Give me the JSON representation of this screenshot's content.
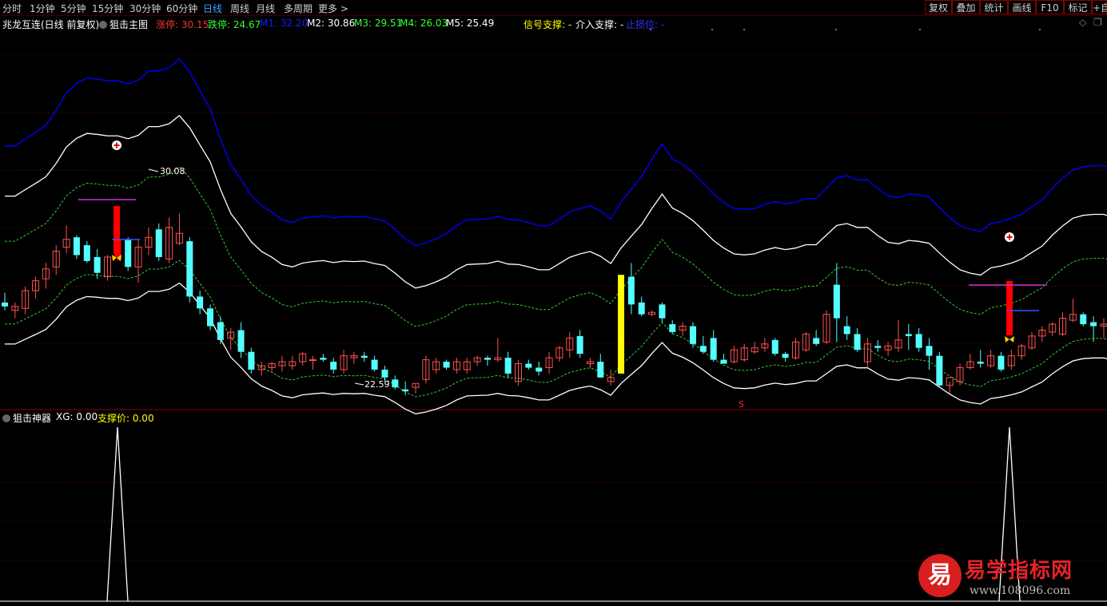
{
  "toolbar": {
    "periods": [
      "分时",
      "1分钟",
      "5分钟",
      "15分钟",
      "30分钟",
      "60分钟",
      "日线",
      "周线",
      "月线",
      "多周期",
      "更多 >"
    ],
    "active_period": "日线",
    "right_buttons": [
      "复权",
      "叠加",
      "统计",
      "画线",
      "F10",
      "标记",
      "+自"
    ]
  },
  "main_panel": {
    "stock_title": "兆龙互连(日线 前复权)",
    "formula_name": "狙击主图",
    "zt_label": "涨停: 30.15",
    "dt_label": "跌停: 24.67",
    "m1_label": "M1: 32.20",
    "m2_label": "M2: 30.86",
    "m3_label": "M3: 29.51",
    "m4_label": "M4: 26.03",
    "m5_label": "M5: 25.49",
    "signal_label": "信号支撑: -",
    "entry_label": "介入支撑: -",
    "stop_label": "止损位: -",
    "high_marker": "30.08",
    "low_marker": "22.59",
    "s_marker": "S",
    "colors": {
      "up": "#ff5050",
      "down": "#54ffff",
      "ma_blue": "#0000ee",
      "ma_white": "#ffffff",
      "ma_green": "#33cc33",
      "grid": "#5a0000",
      "highlight_yellow": "#ffff00",
      "highlight_red": "#ff0000"
    }
  },
  "sub_panel": {
    "name": "狙击神器",
    "xg_label": "XG: 0.00",
    "support_label": "支撑价: 0.00"
  },
  "watermark": {
    "mark": "易",
    "title": "易学指标网",
    "url": "www.108096.com"
  },
  "chart_data": {
    "type": "candlestick",
    "price_range": [
      20.5,
      39.5
    ],
    "ohlc": [
      [
        25.6,
        26.1,
        25.2,
        25.4
      ],
      [
        25.2,
        25.6,
        24.8,
        25.4
      ],
      [
        25.3,
        26.4,
        25.0,
        26.2
      ],
      [
        26.2,
        26.9,
        25.8,
        26.7
      ],
      [
        26.8,
        27.6,
        26.3,
        27.3
      ],
      [
        27.4,
        28.5,
        27.0,
        28.2
      ],
      [
        28.4,
        29.5,
        28.1,
        28.8
      ],
      [
        28.9,
        29.0,
        27.8,
        28.0
      ],
      [
        28.5,
        28.7,
        27.6,
        27.7
      ],
      [
        27.9,
        28.3,
        26.8,
        27.1
      ],
      [
        26.9,
        28.0,
        26.7,
        27.9
      ],
      [
        27.9,
        28.9,
        27.7,
        28.8
      ],
      [
        28.8,
        28.9,
        27.2,
        27.4
      ],
      [
        27.4,
        28.8,
        26.6,
        28.4
      ],
      [
        28.4,
        29.4,
        28.0,
        28.9
      ],
      [
        29.3,
        29.6,
        27.7,
        27.9
      ],
      [
        27.8,
        29.9,
        27.6,
        29.4
      ],
      [
        28.6,
        30.1,
        28.5,
        29.1
      ],
      [
        28.7,
        28.9,
        25.6,
        25.9
      ],
      [
        25.9,
        26.2,
        25.0,
        25.3
      ],
      [
        25.3,
        25.5,
        24.2,
        24.4
      ],
      [
        24.6,
        24.9,
        23.5,
        23.7
      ],
      [
        23.8,
        24.3,
        23.2,
        24.1
      ],
      [
        24.2,
        24.6,
        22.8,
        23.1
      ],
      [
        23.1,
        23.3,
        22.0,
        22.2
      ],
      [
        22.2,
        22.6,
        21.9,
        22.4
      ],
      [
        22.3,
        22.6,
        22.1,
        22.5
      ],
      [
        22.4,
        22.9,
        22.1,
        22.6
      ],
      [
        22.4,
        22.9,
        22.2,
        22.6
      ],
      [
        22.6,
        23.1,
        22.4,
        23.0
      ],
      [
        22.7,
        22.9,
        22.2,
        22.7
      ],
      [
        22.8,
        23.0,
        22.6,
        22.7
      ],
      [
        22.6,
        22.8,
        22.0,
        22.2
      ],
      [
        22.2,
        23.2,
        22.0,
        22.9
      ],
      [
        22.8,
        23.1,
        22.5,
        22.9
      ],
      [
        22.9,
        23.1,
        22.6,
        22.8
      ],
      [
        22.7,
        22.9,
        22.1,
        22.2
      ],
      [
        22.2,
        22.4,
        21.6,
        21.8
      ],
      [
        21.7,
        21.9,
        21.2,
        21.3
      ],
      [
        21.2,
        21.6,
        20.9,
        21.1
      ],
      [
        21.3,
        21.5,
        21.0,
        21.5
      ],
      [
        21.7,
        22.9,
        21.5,
        22.7
      ],
      [
        22.2,
        22.8,
        22.0,
        22.6
      ],
      [
        22.6,
        22.7,
        22.2,
        22.3
      ],
      [
        22.2,
        22.8,
        22.0,
        22.6
      ],
      [
        22.2,
        22.8,
        22.0,
        22.6
      ],
      [
        22.6,
        22.9,
        22.4,
        22.8
      ],
      [
        22.8,
        22.9,
        22.4,
        22.7
      ],
      [
        22.7,
        23.8,
        22.6,
        22.8
      ],
      [
        22.8,
        23.1,
        21.8,
        22.0
      ],
      [
        21.6,
        22.7,
        21.4,
        22.5
      ],
      [
        22.5,
        22.7,
        22.2,
        22.3
      ],
      [
        22.3,
        22.6,
        21.9,
        22.1
      ],
      [
        22.3,
        23.1,
        22.0,
        22.8
      ],
      [
        22.8,
        23.4,
        22.6,
        23.3
      ],
      [
        23.2,
        24.1,
        22.8,
        23.8
      ],
      [
        23.9,
        24.2,
        22.8,
        23.0
      ],
      [
        22.5,
        22.8,
        22.3,
        22.6
      ],
      [
        22.6,
        23.0,
        22.0,
        21.8
      ],
      [
        21.6,
        22.2,
        21.4,
        21.8
      ],
      [
        22.0,
        27.0,
        22.0,
        27.0
      ],
      [
        26.9,
        27.6,
        25.0,
        25.5
      ],
      [
        25.6,
        25.9,
        24.9,
        25.0
      ],
      [
        25.0,
        25.2,
        24.9,
        25.1
      ],
      [
        25.5,
        25.6,
        24.6,
        24.8
      ],
      [
        24.5,
        24.7,
        24.0,
        24.1
      ],
      [
        24.2,
        24.6,
        23.9,
        24.4
      ],
      [
        24.4,
        24.6,
        23.3,
        23.5
      ],
      [
        23.4,
        23.9,
        23.0,
        23.1
      ],
      [
        23.8,
        24.2,
        22.6,
        22.7
      ],
      [
        22.7,
        23.0,
        22.5,
        22.5
      ],
      [
        22.6,
        23.4,
        22.5,
        23.2
      ],
      [
        22.7,
        23.5,
        22.6,
        23.3
      ],
      [
        23.1,
        23.6,
        23.0,
        23.3
      ],
      [
        23.3,
        23.8,
        23.1,
        23.5
      ],
      [
        23.7,
        23.8,
        22.9,
        23.0
      ],
      [
        23.0,
        23.1,
        22.6,
        22.8
      ],
      [
        22.8,
        23.8,
        22.7,
        23.6
      ],
      [
        23.2,
        24.1,
        23.1,
        24.0
      ],
      [
        23.8,
        24.2,
        23.4,
        23.5
      ],
      [
        23.6,
        25.2,
        23.5,
        25.0
      ],
      [
        26.5,
        27.6,
        23.6,
        24.8
      ],
      [
        24.4,
        24.9,
        23.7,
        24.0
      ],
      [
        24.0,
        24.3,
        23.1,
        23.2
      ],
      [
        22.6,
        23.8,
        22.3,
        23.5
      ],
      [
        23.4,
        23.7,
        23.1,
        23.3
      ],
      [
        23.2,
        23.6,
        22.9,
        23.4
      ],
      [
        23.3,
        24.7,
        23.1,
        23.7
      ],
      [
        24.0,
        24.5,
        23.2,
        23.9
      ],
      [
        24.0,
        24.3,
        23.1,
        23.3
      ],
      [
        23.4,
        23.8,
        22.2,
        22.9
      ],
      [
        22.9,
        23.1,
        21.3,
        21.4
      ],
      [
        21.4,
        21.6,
        21.0,
        21.8
      ],
      [
        21.6,
        22.5,
        21.4,
        22.3
      ],
      [
        22.3,
        23.0,
        22.2,
        22.6
      ],
      [
        22.6,
        23.2,
        22.3,
        22.5
      ],
      [
        22.4,
        23.2,
        22.3,
        22.9
      ],
      [
        22.9,
        23.1,
        22.1,
        22.2
      ],
      [
        22.4,
        23.2,
        22.2,
        22.9
      ],
      [
        22.9,
        23.5,
        22.7,
        23.4
      ],
      [
        23.3,
        24.1,
        23.2,
        23.9
      ],
      [
        23.9,
        24.4,
        23.6,
        24.2
      ],
      [
        24.1,
        24.6,
        23.9,
        24.5
      ],
      [
        24.0,
        25.1,
        23.9,
        24.8
      ],
      [
        24.7,
        25.8,
        24.6,
        25.0
      ],
      [
        25.0,
        25.1,
        24.4,
        24.5
      ],
      [
        24.6,
        24.9,
        23.6,
        24.4
      ],
      [
        24.4,
        24.8,
        23.8,
        24.5
      ],
      [
        24.5,
        26.0,
        23.7,
        24.1
      ],
      [
        24.1,
        24.3,
        23.8,
        24.0
      ],
      [
        24.0,
        24.5,
        22.8,
        22.9
      ],
      [
        23.0,
        25.1,
        22.9,
        24.7
      ],
      [
        24.5,
        25.1,
        24.4,
        24.7
      ],
      [
        24.6,
        24.9,
        24.2,
        24.3
      ],
      [
        24.3,
        24.5,
        23.0,
        23.1
      ],
      [
        23.2,
        23.8,
        23.0,
        23.7
      ],
      [
        23.7,
        25.0,
        23.6,
        24.8
      ],
      [
        24.8,
        25.9,
        24.7,
        25.2
      ],
      [
        25.3,
        26.5,
        25.2,
        26.0
      ]
    ],
    "bottom_signals": [
      8,
      154
    ]
  }
}
